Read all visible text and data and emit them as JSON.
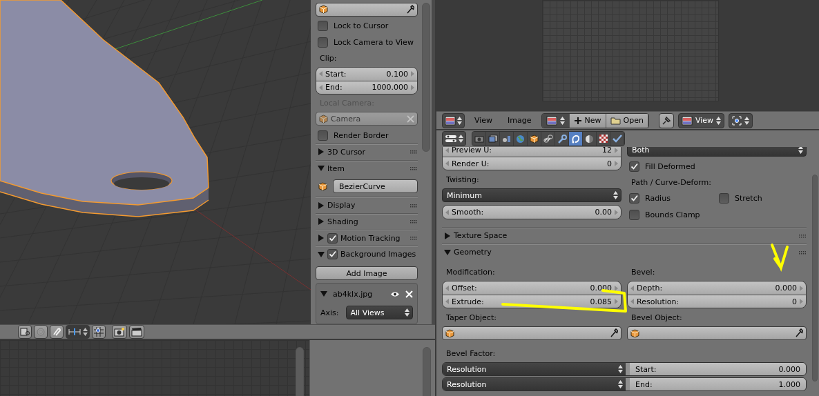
{
  "n_panel": {
    "rows": [
      {
        "kind": "object-picker"
      },
      {
        "kind": "checkbox",
        "label": "Lock to Cursor",
        "checked": false
      },
      {
        "kind": "checkbox",
        "label": "Lock Camera to View",
        "checked": false
      },
      {
        "kind": "label",
        "text": "Clip:",
        "disabled": false
      },
      {
        "kind": "numbers",
        "fields": [
          {
            "label": "Start:",
            "value": "0.100"
          },
          {
            "label": "End:",
            "value": "1000.000"
          }
        ]
      },
      {
        "kind": "label",
        "text": "Local Camera:",
        "disabled": true
      },
      {
        "kind": "object-field",
        "value": "Camera",
        "disabled": true
      },
      {
        "kind": "checkbox",
        "label": "Render Border",
        "checked": false
      },
      {
        "kind": "header",
        "title": "3D Cursor",
        "expanded": false,
        "grip": true
      },
      {
        "kind": "header",
        "title": "Item",
        "expanded": true,
        "grip": true
      },
      {
        "kind": "name-field",
        "value": "BezierCurve"
      },
      {
        "kind": "header",
        "title": "Display",
        "expanded": false,
        "grip": true
      },
      {
        "kind": "header",
        "title": "Shading",
        "expanded": false,
        "grip": true
      },
      {
        "kind": "header",
        "title": "Motion Tracking",
        "expanded": false,
        "checked": true,
        "grip": true
      },
      {
        "kind": "header",
        "title": "Background Images",
        "expanded": true,
        "checked": true,
        "grip": false
      },
      {
        "kind": "button",
        "label": "Add Image"
      },
      {
        "kind": "image-box",
        "name": "ab4klx.jpg",
        "expanded": true,
        "axis_label": "Axis:",
        "axis_value": "All Views"
      }
    ]
  },
  "image_editor": {
    "menus": [
      {
        "label": "View"
      },
      {
        "label": "Image"
      }
    ],
    "new_label": "New",
    "open_label": "Open",
    "view_label": "View"
  },
  "properties": {
    "tabs": [
      {
        "selected": false
      },
      {
        "selected": false
      },
      {
        "selected": false
      },
      {
        "selected": false
      },
      {
        "selected": false
      },
      {
        "selected": false
      },
      {
        "selected": false
      },
      {
        "selected": true
      },
      {
        "selected": false
      },
      {
        "selected": false
      },
      {
        "selected": false
      }
    ],
    "shape": {
      "left": [
        {
          "kind": "numbers",
          "fields": [
            {
              "label": "Preview U:",
              "value": "12"
            },
            {
              "label": "Render U:",
              "value": "0"
            }
          ]
        },
        {
          "kind": "label",
          "text": "Twisting:"
        },
        {
          "kind": "enum",
          "value": "Minimum"
        },
        {
          "kind": "numbers",
          "fields": [
            {
              "label": "Smooth:",
              "value": "0.00"
            }
          ]
        }
      ],
      "right": [
        {
          "kind": "enum",
          "value": "Both"
        },
        {
          "kind": "checkbox",
          "label": "Fill Deformed",
          "checked": true
        },
        {
          "kind": "label",
          "text": "Path / Curve-Deform:"
        },
        {
          "kind": "checkbox-pair",
          "items": [
            {
              "label": "Radius",
              "checked": true
            },
            {
              "label": "Stretch",
              "checked": false
            }
          ]
        },
        {
          "kind": "checkbox",
          "label": "Bounds Clamp",
          "checked": false
        }
      ]
    },
    "panels": [
      {
        "title": "Texture Space",
        "expanded": false
      },
      {
        "title": "Geometry",
        "expanded": true,
        "left": [
          {
            "kind": "label",
            "text": "Modification:"
          },
          {
            "kind": "numbers",
            "fields": [
              {
                "label": "Offset:",
                "value": "0.000"
              },
              {
                "label": "Extrude:",
                "value": "0.085"
              }
            ]
          },
          {
            "kind": "label",
            "text": "Taper Object:"
          },
          {
            "kind": "object-picker"
          }
        ],
        "right": [
          {
            "kind": "label",
            "text": "Bevel:"
          },
          {
            "kind": "numbers",
            "fields": [
              {
                "label": "Depth:",
                "value": "0.000"
              },
              {
                "label": "Resolution:",
                "value": "0"
              }
            ]
          },
          {
            "kind": "label",
            "text": "Bevel Object:"
          },
          {
            "kind": "object-picker"
          }
        ],
        "bevel_factor": {
          "label": "Bevel Factor:",
          "rows": [
            {
              "mode": "Resolution",
              "label": "Start:",
              "value": "0.000"
            },
            {
              "mode": "Resolution",
              "label": "End:",
              "value": "1.000"
            }
          ]
        }
      }
    ]
  }
}
